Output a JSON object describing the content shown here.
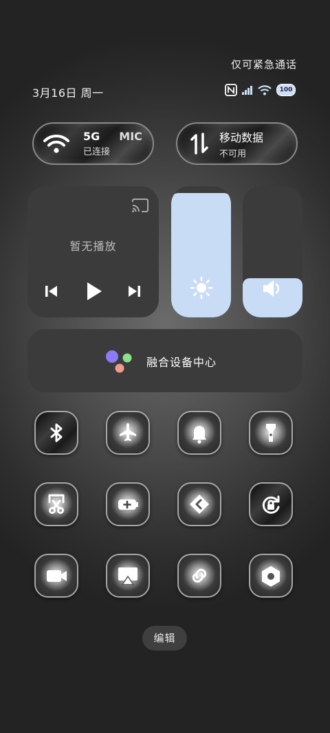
{
  "status": {
    "emergency_text": "仅可紧急通话",
    "date": "3月16日 周一",
    "battery": "100",
    "icons": [
      "nfc-icon",
      "signal-icon",
      "wifi-icon",
      "battery-icon"
    ]
  },
  "wifi_card": {
    "network": "5G",
    "ssid_fragment": "MIC",
    "status": "已连接"
  },
  "mobile_card": {
    "title": "移动数据",
    "status": "不可用"
  },
  "media": {
    "label": "暂无播放",
    "icons": [
      "cast-icon",
      "previous-icon",
      "play-icon",
      "next-icon"
    ]
  },
  "brightness": {
    "level": 0.95,
    "icon": "sun-icon",
    "fill_color": "#c9dcf6"
  },
  "volume": {
    "level": 0.3,
    "icon": "speaker-icon",
    "fill_color": "#c9dcf6"
  },
  "fusion": {
    "label": "融合设备中心",
    "dot_colors": [
      "#8b7cf6",
      "#8ee08a",
      "#f29a8c"
    ]
  },
  "tiles": [
    "bluetooth-icon",
    "airplane-icon",
    "bell-icon",
    "flashlight-icon",
    "screenshot-icon",
    "battery-saver-icon",
    "link-share-icon",
    "rotation-lock-icon",
    "video-icon",
    "screen-cast-icon",
    "chain-link-icon",
    "settings-hex-icon"
  ],
  "edit_button": "编辑"
}
